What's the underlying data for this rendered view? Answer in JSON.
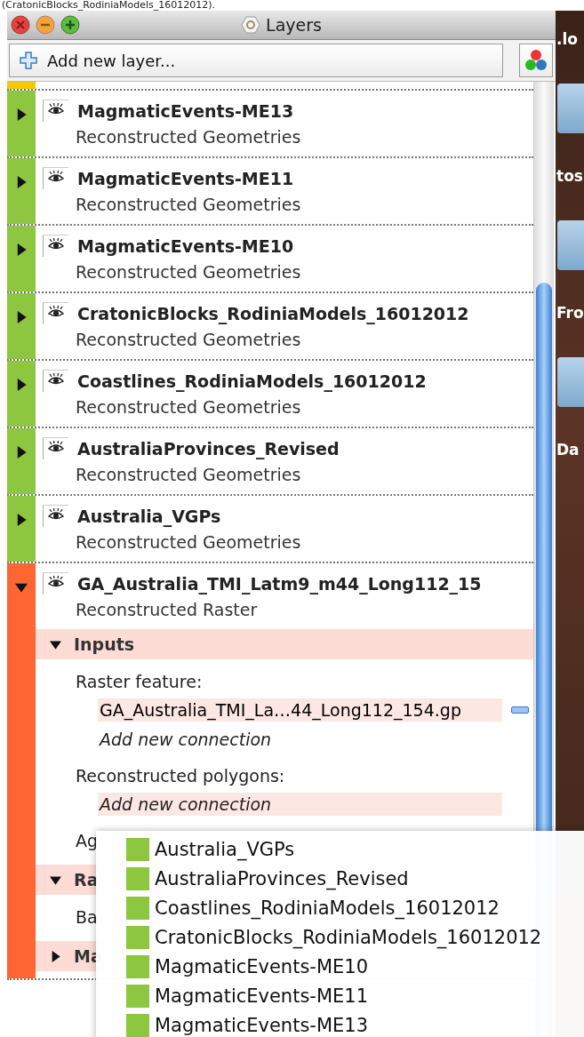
{
  "caption": "(CratonicBlocks_RodiniaModels_16012012).",
  "window": {
    "title": "Layers"
  },
  "toolbar": {
    "add_button": "Add new layer..."
  },
  "hidden_layer_above": {
    "color": "#f6c700"
  },
  "layers": [
    {
      "name": "MagmaticEvents-ME13",
      "type": "Reconstructed Geometries",
      "color": "#8dc63f",
      "expanded": false
    },
    {
      "name": "MagmaticEvents-ME11",
      "type": "Reconstructed Geometries",
      "color": "#8dc63f",
      "expanded": false
    },
    {
      "name": "MagmaticEvents-ME10",
      "type": "Reconstructed Geometries",
      "color": "#8dc63f",
      "expanded": false
    },
    {
      "name": "CratonicBlocks_RodiniaModels_16012012",
      "type": "Reconstructed Geometries",
      "color": "#8dc63f",
      "expanded": false
    },
    {
      "name": "Coastlines_RodiniaModels_16012012",
      "type": "Reconstructed Geometries",
      "color": "#8dc63f",
      "expanded": false
    },
    {
      "name": "AustraliaProvinces_Revised",
      "type": "Reconstructed Geometries",
      "color": "#8dc63f",
      "expanded": false
    },
    {
      "name": "Australia_VGPs",
      "type": "Reconstructed Geometries",
      "color": "#8dc63f",
      "expanded": false
    },
    {
      "name": "GA_Australia_TMI_Latm9_m44_Long112_15",
      "type": "Reconstructed Raster",
      "color": "#ff6633",
      "expanded": true,
      "sections": [
        {
          "title": "Inputs",
          "expanded": true,
          "fields": [
            {
              "label": "Raster feature:",
              "connections": [
                {
                  "kind": "file",
                  "text": "GA_Australia_TMI_La…44_Long112_154.gp",
                  "selected": true
                },
                {
                  "kind": "add",
                  "text": "Add new connection",
                  "selected": false
                }
              ]
            },
            {
              "label": "Reconstructed polygons:",
              "connections": [
                {
                  "kind": "add",
                  "text": "Add new connection",
                  "selected": true
                }
              ]
            },
            {
              "label": "Ag"
            }
          ]
        },
        {
          "title": "Ra",
          "expanded": true,
          "fields": [
            {
              "label": "Ba"
            }
          ]
        },
        {
          "title": "Ma",
          "expanded": false
        }
      ]
    }
  ],
  "popup_menu": {
    "items": [
      {
        "label": "Australia_VGPs",
        "color": "#8dc63f"
      },
      {
        "label": "AustraliaProvinces_Revised",
        "color": "#8dc63f"
      },
      {
        "label": "Coastlines_RodiniaModels_16012012",
        "color": "#8dc63f"
      },
      {
        "label": "CratonicBlocks_RodiniaModels_16012012",
        "color": "#8dc63f"
      },
      {
        "label": "MagmaticEvents-ME10",
        "color": "#8dc63f"
      },
      {
        "label": "MagmaticEvents-ME11",
        "color": "#8dc63f"
      },
      {
        "label": "MagmaticEvents-ME13",
        "color": "#8dc63f"
      }
    ]
  },
  "desktop": {
    "icons": [
      {
        "label": ".lo",
        "folder": false
      },
      {
        "label": "tos",
        "folder": true
      },
      {
        "label": "Fro",
        "folder": true
      },
      {
        "label": "Da",
        "folder": true
      }
    ]
  }
}
